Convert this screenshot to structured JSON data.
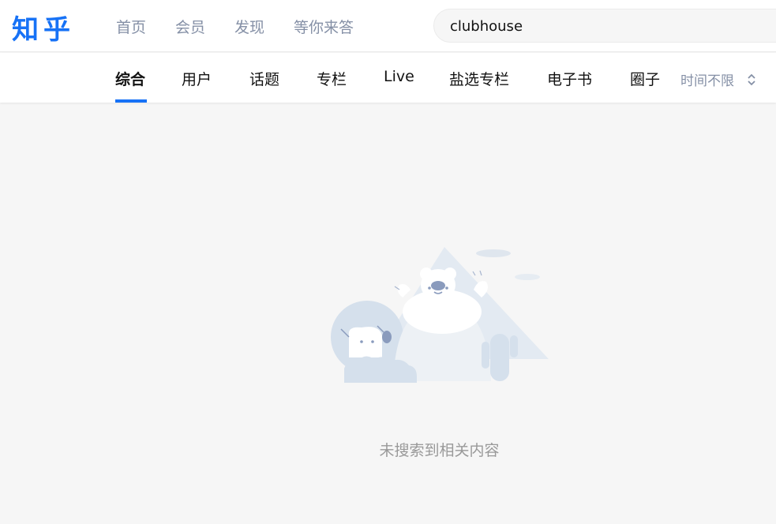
{
  "header": {
    "logo": "知乎",
    "nav": [
      "首页",
      "会员",
      "发现",
      "等你来答"
    ]
  },
  "search": {
    "value": "clubhouse"
  },
  "tabs": [
    "综合",
    "用户",
    "话题",
    "专栏",
    "Live",
    "盐选专栏",
    "电子书",
    "圈子"
  ],
  "active_tab": "综合",
  "time_filter": {
    "label": "时间不限",
    "icon": "updown-chevron-icon"
  },
  "empty_state": {
    "illustration": "empty-search-illustration",
    "message": "未搜索到相关内容"
  },
  "colors": {
    "brand": "#1772f6",
    "nav_text": "#8590a6",
    "empty_text": "#999999",
    "page_bg": "#f6f6f6"
  }
}
